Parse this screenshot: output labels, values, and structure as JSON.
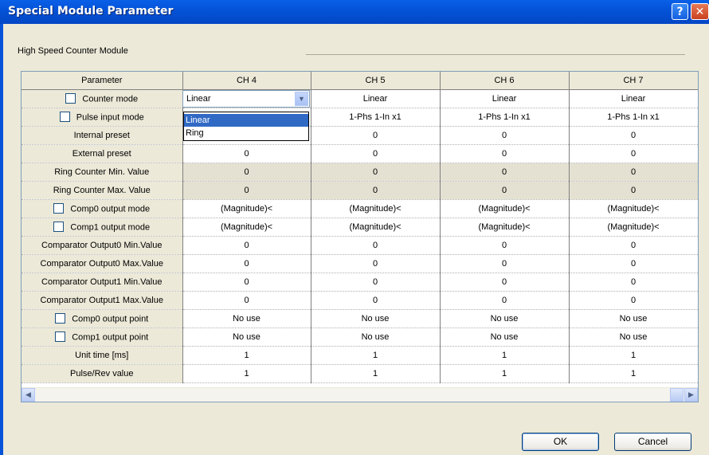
{
  "window": {
    "title": "Special Module Parameter",
    "help_glyph": "?",
    "close_glyph": "✕"
  },
  "group": {
    "caption": "High Speed Counter Module"
  },
  "table": {
    "columns": [
      "Parameter",
      "CH 4",
      "CH 5",
      "CH 6",
      "CH 7"
    ],
    "rows": [
      {
        "label": "Counter mode",
        "checkbox": true,
        "values": [
          "Linear",
          "Linear",
          "Linear",
          "Linear"
        ]
      },
      {
        "label": "Pulse input mode",
        "checkbox": true,
        "values": [
          "",
          "1-Phs 1-In x1",
          "1-Phs 1-In x1",
          "1-Phs 1-In x1"
        ]
      },
      {
        "label": "Internal preset",
        "checkbox": false,
        "values": [
          "",
          "0",
          "0",
          "0"
        ]
      },
      {
        "label": "External preset",
        "checkbox": false,
        "values": [
          "0",
          "0",
          "0",
          "0"
        ]
      },
      {
        "label": "Ring Counter Min. Value",
        "checkbox": false,
        "shaded": true,
        "values": [
          "0",
          "0",
          "0",
          "0"
        ]
      },
      {
        "label": "Ring Counter Max. Value",
        "checkbox": false,
        "shaded": true,
        "values": [
          "0",
          "0",
          "0",
          "0"
        ]
      },
      {
        "label": "Comp0 output mode",
        "checkbox": true,
        "values": [
          "(Magnitude)<",
          "(Magnitude)<",
          "(Magnitude)<",
          "(Magnitude)<"
        ]
      },
      {
        "label": "Comp1 output mode",
        "checkbox": true,
        "values": [
          "(Magnitude)<",
          "(Magnitude)<",
          "(Magnitude)<",
          "(Magnitude)<"
        ]
      },
      {
        "label": "Comparator Output0 Min.Value",
        "checkbox": false,
        "values": [
          "0",
          "0",
          "0",
          "0"
        ]
      },
      {
        "label": "Comparator Output0 Max.Value",
        "checkbox": false,
        "values": [
          "0",
          "0",
          "0",
          "0"
        ]
      },
      {
        "label": "Comparator Output1 Min.Value",
        "checkbox": false,
        "values": [
          "0",
          "0",
          "0",
          "0"
        ]
      },
      {
        "label": "Comparator Output1 Max.Value",
        "checkbox": false,
        "values": [
          "0",
          "0",
          "0",
          "0"
        ]
      },
      {
        "label": "Comp0 output point",
        "checkbox": true,
        "values": [
          "No use",
          "No use",
          "No use",
          "No use"
        ]
      },
      {
        "label": "Comp1 output point",
        "checkbox": true,
        "values": [
          "No use",
          "No use",
          "No use",
          "No use"
        ]
      },
      {
        "label": "Unit time [ms]",
        "checkbox": false,
        "values": [
          "1",
          "1",
          "1",
          "1"
        ]
      },
      {
        "label": "Pulse/Rev value",
        "checkbox": false,
        "values": [
          "1",
          "1",
          "1",
          "1"
        ]
      }
    ]
  },
  "combo": {
    "value": "Linear",
    "options": [
      "Linear",
      "Ring"
    ],
    "highlighted": "Linear"
  },
  "buttons": {
    "ok": "OK",
    "cancel": "Cancel"
  }
}
